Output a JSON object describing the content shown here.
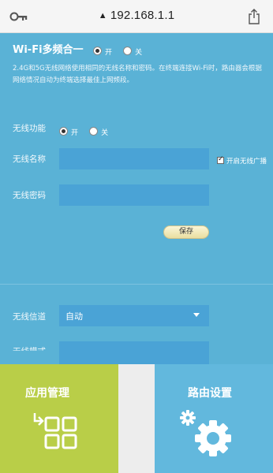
{
  "browser": {
    "url": "192.168.1.1",
    "icons": {
      "left": "key-icon",
      "lock": "lock-icon",
      "right": "share-icon"
    }
  },
  "wifi_multiband": {
    "title": "Wi-Fi多频合一",
    "options": [
      {
        "label": "开",
        "selected": true
      },
      {
        "label": "关",
        "selected": false
      }
    ],
    "description": "2.4G和5G无线网络使用相同的无线名称和密码。在终端连接Wi-Fi时，路由器会根据网络情况自动为终端选择最佳上网频段。"
  },
  "wireless": {
    "function_label": "无线功能",
    "function_options": [
      {
        "label": "开",
        "selected": true
      },
      {
        "label": "关",
        "selected": false
      }
    ],
    "name_label": "无线名称",
    "name_value": "",
    "broadcast_label": "开启无线广播",
    "broadcast_checked": true,
    "password_label": "无线密码",
    "password_value": "",
    "save_label": "保存",
    "channel_label": "无线信道",
    "channel_value": "自动",
    "mode_label": "无线模式"
  },
  "tiles": {
    "app_mgmt": "应用管理",
    "router_settings": "路由设置"
  },
  "colors": {
    "content_bg": "#5ab2d6",
    "field_bg": "#4aa3d6",
    "app_tile": "#b9ce48",
    "router_tile": "#62b8dd",
    "save_btn": "#efe3a8"
  }
}
